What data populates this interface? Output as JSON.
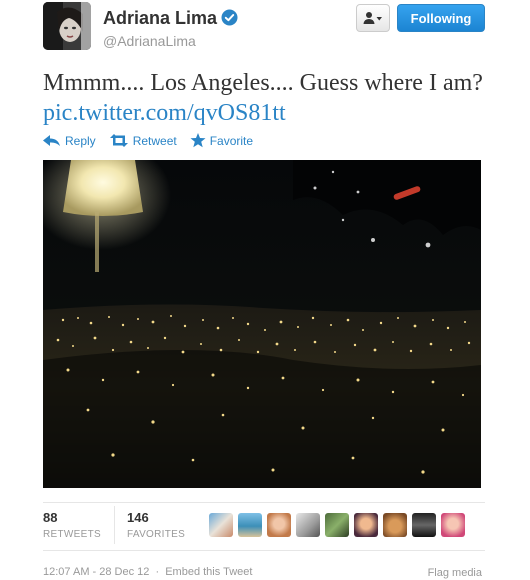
{
  "user": {
    "name": "Adriana Lima",
    "handle": "@AdrianaLima",
    "verified": true
  },
  "buttons": {
    "user_menu_icon": "person-dropdown-icon",
    "follow_label": "Following"
  },
  "tweet": {
    "text": "Mmmm.... Los Angeles.... Guess where I am?",
    "link": "pic.twitter.com/qvOS81tt"
  },
  "actions": {
    "reply": "Reply",
    "retweet": "Retweet",
    "favorite": "Favorite"
  },
  "stats": {
    "retweets_count": "88",
    "retweets_label": "RETWEETS",
    "favorites_count": "146",
    "favorites_label": "FAVORITES"
  },
  "footer": {
    "timestamp": "12:07 AM - 28 Dec 12",
    "separator": "·",
    "embed": "Embed this Tweet",
    "flag": "Flag media"
  },
  "colors": {
    "link_blue": "#2a84c6",
    "follow_button": "#1c84d2",
    "text": "#333333",
    "muted": "#999999"
  }
}
